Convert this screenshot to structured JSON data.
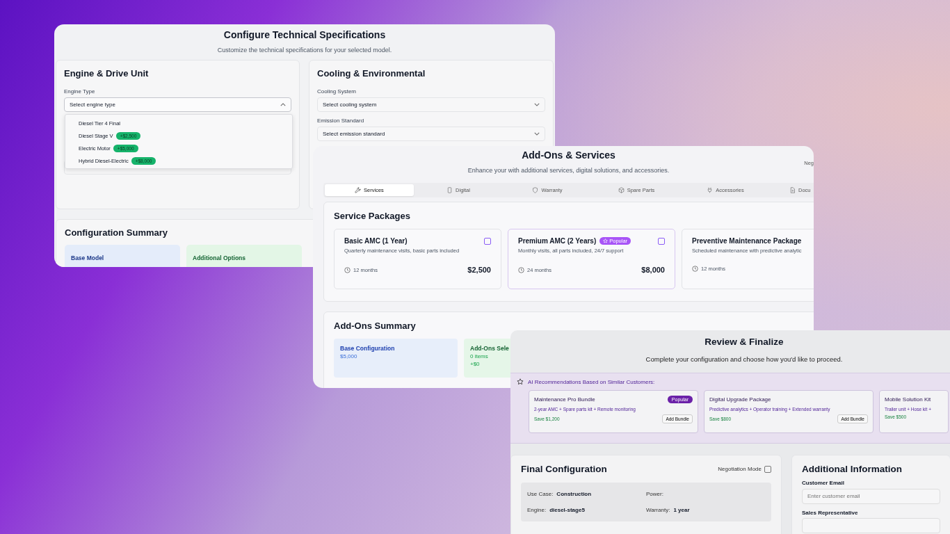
{
  "tech_specs": {
    "title": "Configure Technical Specifications",
    "subtitle": "Customize the technical specifications for your selected model.",
    "engine_panel": {
      "heading": "Engine & Drive Unit",
      "engine_type": {
        "label": "Engine Type",
        "placeholder": "Select engine type",
        "expanded": true,
        "options": [
          {
            "label": "Diesel Tier 4 Final"
          },
          {
            "label": "Diesel Stage V",
            "price": "+$2,500"
          },
          {
            "label": "Electric Motor",
            "price": "+$5,000"
          },
          {
            "label": "Hybrid Diesel-Electric",
            "price": "+$8,000"
          }
        ]
      }
    },
    "cooling_panel": {
      "heading": "Cooling & Environmental",
      "fields": [
        {
          "label": "Cooling System",
          "placeholder": "Select cooling system"
        },
        {
          "label": "Emission Standard",
          "placeholder": "Select emission standard"
        }
      ]
    },
    "summary": {
      "heading": "Configuration Summary",
      "cards": [
        {
          "title": "Base Model",
          "color": "#e4ecfa"
        },
        {
          "title": "Additional Options",
          "color": "#e3f6e6"
        }
      ]
    }
  },
  "addons": {
    "title": "Add-Ons & Services",
    "subtitle": "Enhance your with additional services, digital solutions, and accessories.",
    "corner_text": "Neg",
    "tabs": [
      {
        "label": "Services",
        "selected": true
      },
      {
        "label": "Digital",
        "selected": false
      },
      {
        "label": "Warranty",
        "selected": false
      },
      {
        "label": "Spare Parts",
        "selected": false
      },
      {
        "label": "Accessories",
        "selected": false
      },
      {
        "label": "Docu",
        "selected": false
      }
    ],
    "packages_heading": "Service Packages",
    "packages": [
      {
        "name": "Basic AMC (1 Year)",
        "description": "Quarterly maintenance visits, basic parts included",
        "duration": "12 months",
        "price": "$2,500",
        "checked": false
      },
      {
        "name": "Premium AMC (2 Years)",
        "badge": "Popular",
        "description": "Monthly visits, all parts included, 24/7 support",
        "duration": "24 months",
        "price": "$8,000",
        "checked": false
      },
      {
        "name": "Preventive Maintenance Package",
        "description": "Scheduled maintenance with predictive analytic",
        "duration": "12 months"
      }
    ],
    "summary": {
      "heading": "Add-Ons Summary",
      "cards": [
        {
          "title": "Base Configuration",
          "lines": [
            "$5,000"
          ],
          "color": "#e7eefa"
        },
        {
          "title": "Add-Ons Sele",
          "lines": [
            "0 items",
            "+$0"
          ],
          "color": "#e5f6e8"
        }
      ]
    }
  },
  "review": {
    "title": "Review & Finalize",
    "subtitle": "Complete your configuration and choose how you'd like to proceed.",
    "recommendations": {
      "heading": "AI Recommendations Based on Similar Customers:",
      "bundles": [
        {
          "name": "Maintenance Pro Bundle",
          "badge": "Popular",
          "description": "2-year AMC + Spare parts kit + Remote monitoring",
          "savings": "Save $1,200",
          "button": "Add Bundle"
        },
        {
          "name": "Digital Upgrade Package",
          "description": "Predictive analytics + Operator training + Extended warranty",
          "savings": "Save $800",
          "button": "Add Bundle"
        },
        {
          "name": "Mobile Solution Kit",
          "description": "Trailer unit + Hose kit +",
          "savings": "Save $500"
        }
      ]
    },
    "final": {
      "heading": "Final Configuration",
      "negotiation": {
        "label": "Negotiation Mode",
        "checked": false
      },
      "details": [
        {
          "label": "Use Case:",
          "value": "Construction"
        },
        {
          "label": "Power:"
        },
        {
          "label": "Engine:",
          "value": "diesel-stage5"
        },
        {
          "label": "Warranty:",
          "value": "1 year"
        }
      ]
    },
    "additional": {
      "heading": "Additional Information",
      "fields": [
        {
          "label": "Customer Email",
          "placeholder": "Enter customer email"
        },
        {
          "label": "Sales Representative"
        }
      ]
    }
  }
}
